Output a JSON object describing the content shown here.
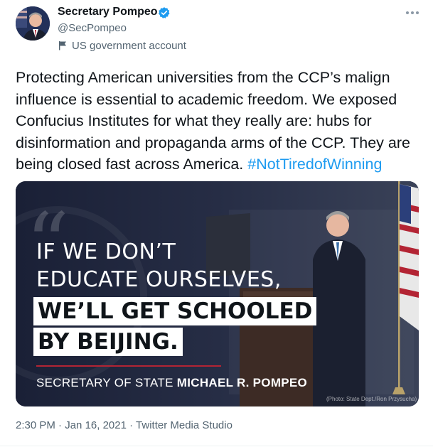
{
  "author": {
    "name": "Secretary Pompeo",
    "handle": "@SecPompeo",
    "label": "US government account",
    "verified": true,
    "label_icon": "flag-icon",
    "menu_icon": "more-icon"
  },
  "tweet": {
    "text_before": "Protecting American universities from the CCP’s malign influence is essential to academic freedom. We exposed Confucius Institutes for what they really are: hubs for disinformation and propaganda arms of the CCP. They are being closed fast across America. ",
    "hashtag": "#NotTiredofWinning"
  },
  "media": {
    "quote_glyph": "“",
    "line1": "IF WE DON’T",
    "line2": "EDUCATE OURSELVES,",
    "line3": "WE’LL GET SCHOOLED",
    "line4": "BY BEIJING.",
    "caption_prefix": "SECRETARY OF STATE ",
    "caption_name": "MICHAEL R. POMPEO",
    "credit": "(Photo: State Dept./Ron Przysucha)"
  },
  "meta": {
    "time": "2:30 PM",
    "separator": " · ",
    "date": "Jan 16, 2021",
    "source": "Twitter Media Studio"
  },
  "colors": {
    "link": "#1d9bf0",
    "secondary_text": "#536471",
    "verified_badge": "#1d9bf0",
    "media_background": "#1c2238",
    "accent_red": "#b32434"
  }
}
